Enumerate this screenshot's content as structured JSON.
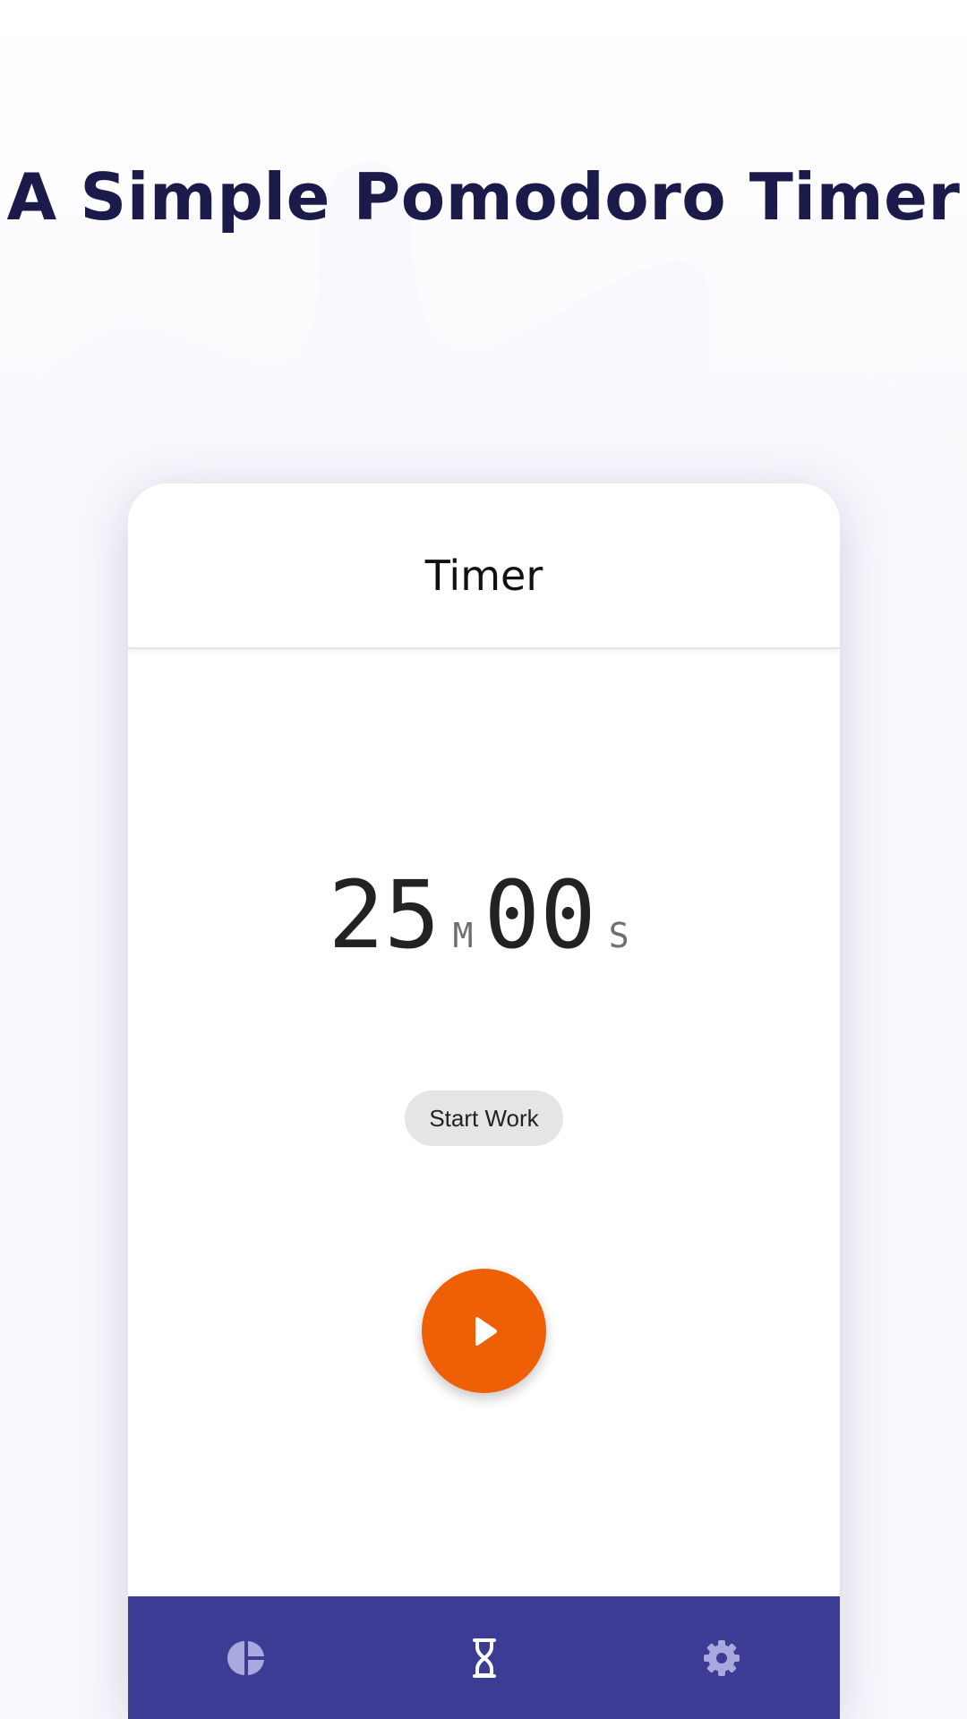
{
  "headline": "A Simple Pomodoro Timer",
  "app": {
    "title": "Timer",
    "timer": {
      "minutes": "25",
      "minutes_unit": "M",
      "seconds": "00",
      "seconds_unit": "S"
    },
    "status_chip": "Start Work",
    "play_button": {
      "icon": "play-icon",
      "color": "#ef6006"
    },
    "bottom_nav": {
      "background": "#3c3c94",
      "items": [
        {
          "icon": "pie-chart-icon",
          "selected": false
        },
        {
          "icon": "hourglass-icon",
          "selected": true
        },
        {
          "icon": "gear-icon",
          "selected": false
        }
      ]
    }
  },
  "colors": {
    "headline": "#1b1b4b",
    "accent": "#ef6006",
    "nav": "#3c3c94",
    "nav_icon_inactive": "#a9a9df",
    "nav_icon_active": "#ffffff"
  }
}
